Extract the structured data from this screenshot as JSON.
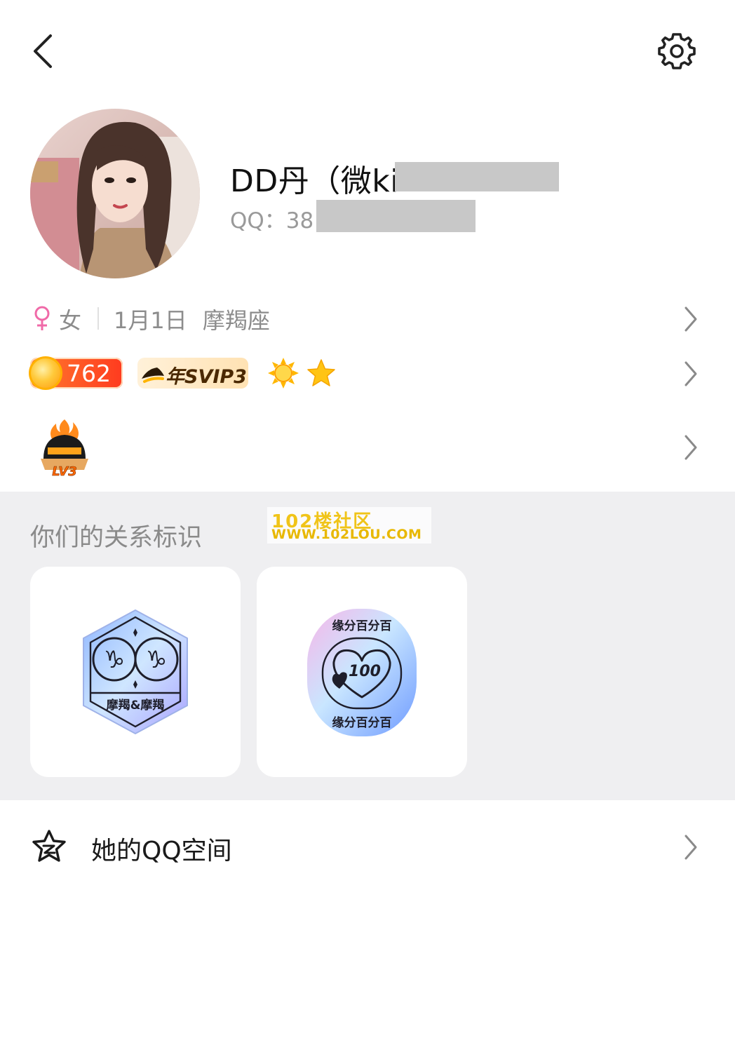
{
  "header": {
    "back_icon": "chevron-left-icon",
    "settings_icon": "gear-icon"
  },
  "profile": {
    "nickname": "DD丹（微ki",
    "qq_label": "QQ：38",
    "avatar": "user-avatar-photo"
  },
  "info": {
    "gender_icon": "female-icon",
    "gender": "女",
    "birthday": "1月1日",
    "zodiac": "摩羯座"
  },
  "badges": {
    "level_value": "762",
    "svip_label": "年SVIP3",
    "sun_icon": "sun-icon",
    "star_icon": "star-icon"
  },
  "game_level": {
    "label": "LV3"
  },
  "relationship": {
    "title": "你们的关系标识",
    "cards": [
      {
        "label": "摩羯&摩羯",
        "icon": "capricorn-pair-badge"
      },
      {
        "label_top": "缘分百分百",
        "label_bottom": "缘分百分百",
        "value": "100",
        "icon": "heart-100-badge"
      }
    ]
  },
  "watermark": {
    "line1": "102楼社区",
    "line2": "WWW.102LOU.COM"
  },
  "qzone": {
    "label": "她的QQ空间",
    "icon": "qzone-star-icon"
  },
  "colors": {
    "accent_pink": "#f06aa8",
    "level_orange": "#ff5a24",
    "section_bg": "#efeff1",
    "secondary_text": "#8c8c8c"
  }
}
